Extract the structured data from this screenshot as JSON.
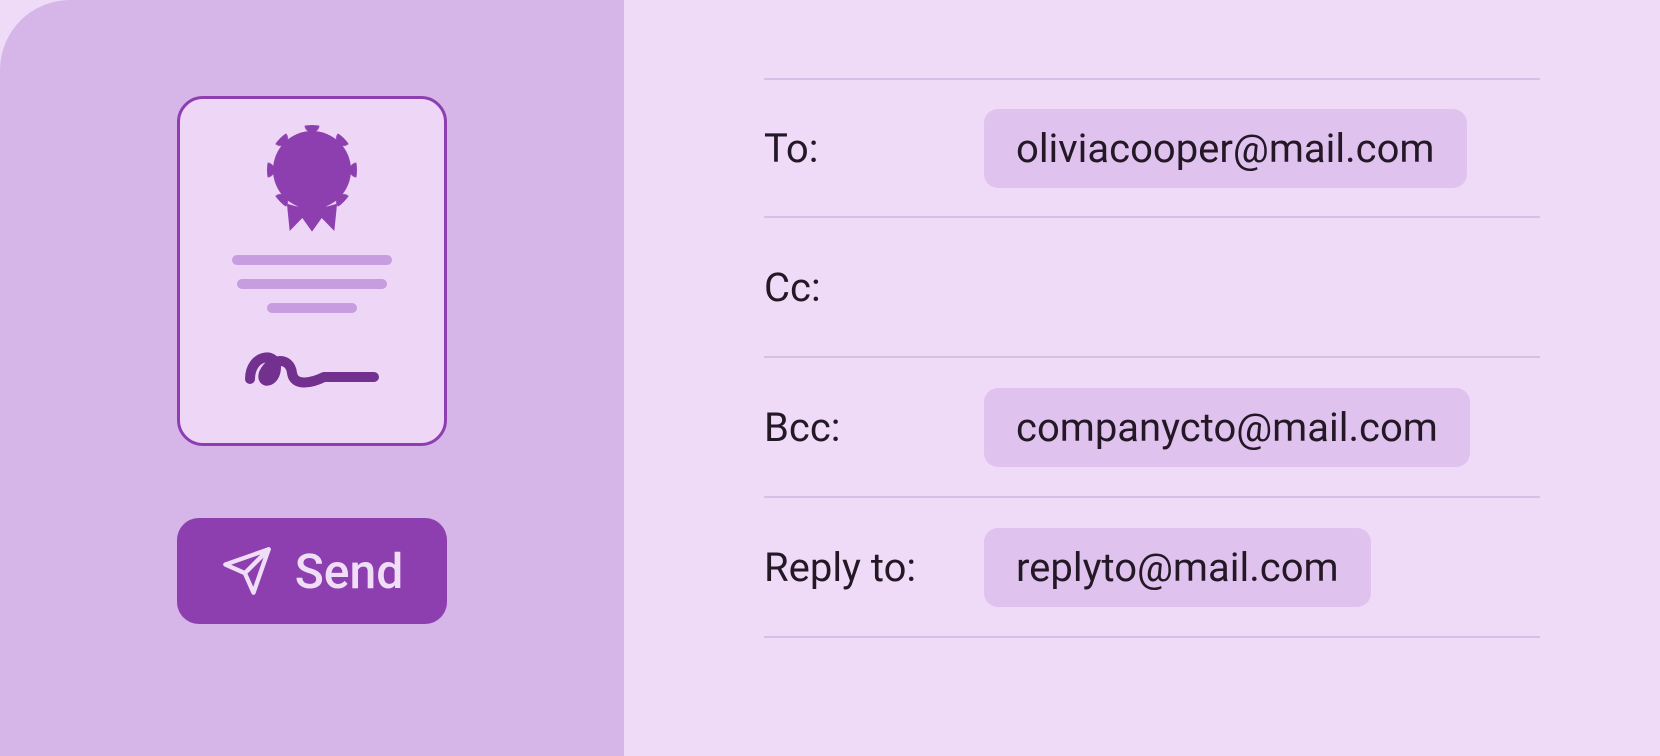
{
  "left": {
    "send_label": "Send"
  },
  "fields": {
    "to": {
      "label": "To:",
      "value": "oliviacooper@mail.com"
    },
    "cc": {
      "label": "Cc:",
      "value": ""
    },
    "bcc": {
      "label": "Bcc:",
      "value": "companycto@mail.com"
    },
    "replyto": {
      "label": "Reply to:",
      "value": "replyto@mail.com"
    }
  }
}
